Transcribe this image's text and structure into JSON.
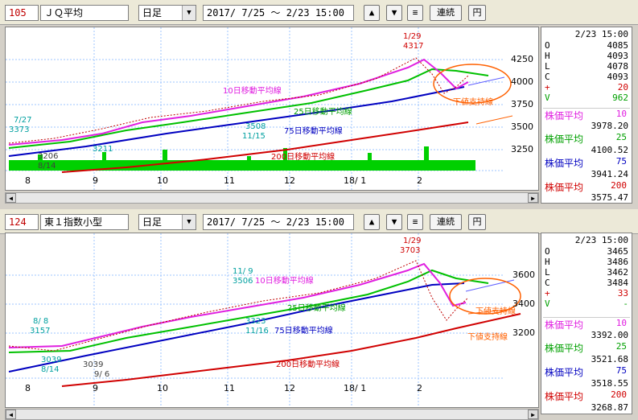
{
  "panels": [
    {
      "code": "105",
      "name": "ＪＱ平均",
      "period": "日足",
      "range": "2017/ 7/25 ～  2/23 15:00",
      "buttons": {
        "up": "▲",
        "down": "▼",
        "menu": "≡",
        "link": "連続",
        "yen": "円"
      },
      "side": {
        "datetime": "2/23 15:00",
        "ohlc": [
          {
            "k": "O",
            "v": "4085"
          },
          {
            "k": "H",
            "v": "4093"
          },
          {
            "k": "L",
            "v": "4078"
          },
          {
            "k": "C",
            "v": "4093"
          },
          {
            "k": "+",
            "v": "20"
          },
          {
            "k": "V",
            "v": "962"
          }
        ],
        "ma": [
          {
            "label": "株価平均",
            "period": "10",
            "value": "3978.20",
            "color": "#e020e0"
          },
          {
            "label": "株価平均",
            "period": "25",
            "value": "4100.52",
            "color": "#00a000"
          },
          {
            "label": "株価平均",
            "period": "75",
            "value": "3941.24",
            "color": "#0000c0"
          },
          {
            "label": "株価平均",
            "period": "200",
            "value": "3575.47",
            "color": "#d00000"
          }
        ]
      },
      "chart": {
        "y_ticks": [
          "4250",
          "4000",
          "3750",
          "3500",
          "3250"
        ],
        "x_ticks": [
          "8",
          "9",
          "10",
          "11",
          "12",
          "18/ 1",
          "2"
        ],
        "annotations": [
          {
            "text": "1/29",
            "color": "#d00000"
          },
          {
            "text": "4317",
            "color": "#d00000"
          },
          {
            "text": "7/27",
            "color": "#00a0a0"
          },
          {
            "text": "3373",
            "color": "#00a0a0"
          },
          {
            "text": "3206",
            "color": "#404040"
          },
          {
            "text": "8/14",
            "color": "#404040"
          },
          {
            "text": "3211",
            "color": "#00a0a0"
          },
          {
            "text": "3508",
            "color": "#00a0a0"
          },
          {
            "text": "11/15",
            "color": "#00a0a0"
          },
          {
            "text": "10日移動平均線",
            "color": "#e020e0"
          },
          {
            "text": "25日移動平均線",
            "color": "#00a000"
          },
          {
            "text": "75日移動平均線",
            "color": "#0000c0"
          },
          {
            "text": "200日移動平均線",
            "color": "#d00000"
          },
          {
            "text": "下値支持線",
            "color": "#ff6000"
          }
        ]
      }
    },
    {
      "code": "124",
      "name": "東１指数小型",
      "period": "日足",
      "range": "2017/ 7/25 ～  2/23 15:00",
      "buttons": {
        "up": "▲",
        "down": "▼",
        "menu": "≡",
        "link": "連続",
        "yen": "円"
      },
      "side": {
        "datetime": "2/23 15:00",
        "ohlc": [
          {
            "k": "O",
            "v": "3465"
          },
          {
            "k": "H",
            "v": "3486"
          },
          {
            "k": "L",
            "v": "3462"
          },
          {
            "k": "C",
            "v": "3484"
          },
          {
            "k": "+",
            "v": "33"
          },
          {
            "k": "V",
            "v": "-"
          }
        ],
        "ma": [
          {
            "label": "株価平均",
            "period": "10",
            "value": "3392.00",
            "color": "#e020e0"
          },
          {
            "label": "株価平均",
            "period": "25",
            "value": "3521.68",
            "color": "#00a000"
          },
          {
            "label": "株価平均",
            "period": "75",
            "value": "3518.55",
            "color": "#0000c0"
          },
          {
            "label": "株価平均",
            "period": "200",
            "value": "3268.87",
            "color": "#d00000"
          }
        ]
      },
      "chart": {
        "y_ticks": [
          "3600",
          "3400",
          "3200"
        ],
        "x_ticks": [
          "8",
          "9",
          "10",
          "11",
          "12",
          "18/ 1",
          "2"
        ],
        "annotations": [
          {
            "text": "1/29",
            "color": "#d00000"
          },
          {
            "text": "3703",
            "color": "#d00000"
          },
          {
            "text": "8/ 8",
            "color": "#00a0a0"
          },
          {
            "text": "3157",
            "color": "#00a0a0"
          },
          {
            "text": "3039",
            "color": "#00a0a0"
          },
          {
            "text": "8/14",
            "color": "#00a0a0"
          },
          {
            "text": "3039",
            "color": "#404040"
          },
          {
            "text": "9/ 6",
            "color": "#404040"
          },
          {
            "text": "11/ 9",
            "color": "#00a0a0"
          },
          {
            "text": "3506",
            "color": "#00a0a0"
          },
          {
            "text": "3323",
            "color": "#00a0a0"
          },
          {
            "text": "11/16",
            "color": "#00a0a0"
          },
          {
            "text": "10日移動平均線",
            "color": "#e020e0"
          },
          {
            "text": "25日移動平均線",
            "color": "#00a000"
          },
          {
            "text": "75日移動平均線",
            "color": "#0000c0"
          },
          {
            "text": "200日移動平均線",
            "color": "#d00000"
          },
          {
            "text": "下値支持線",
            "color": "#ff6000"
          },
          {
            "text": "下値支持線",
            "color": "#ff6000"
          }
        ]
      }
    }
  ]
}
